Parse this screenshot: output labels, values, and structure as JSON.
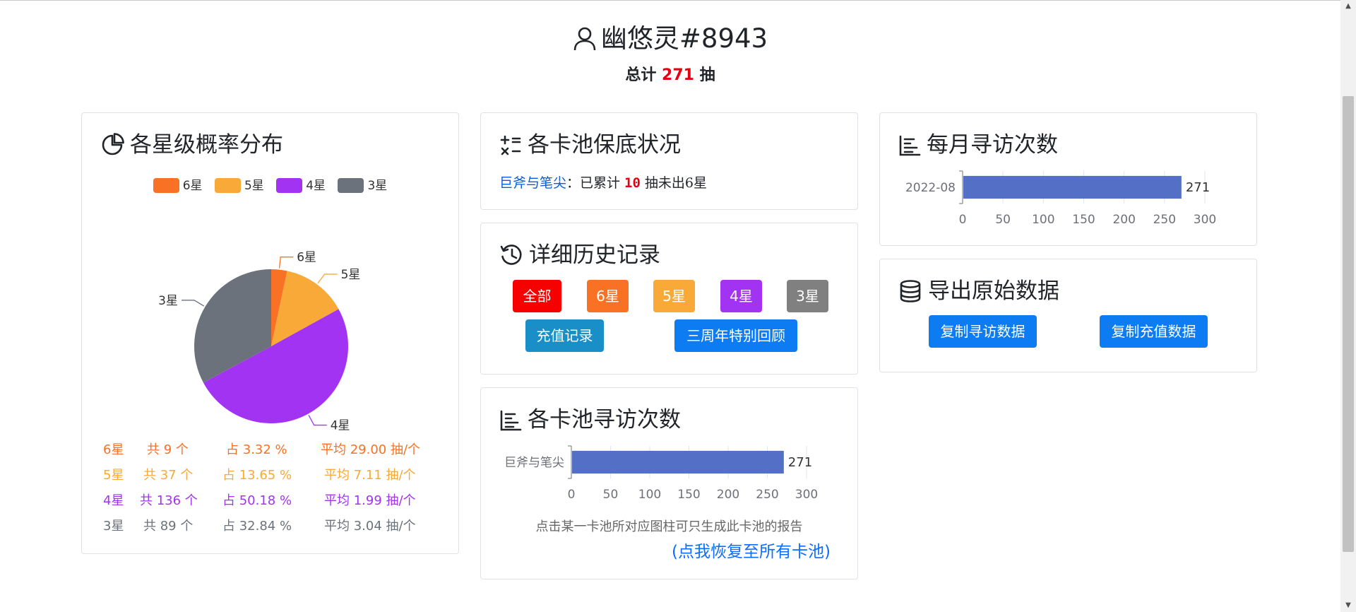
{
  "header": {
    "username": "幽悠灵#8943",
    "total_prefix": "总计",
    "total_count": "271",
    "total_suffix": "抽"
  },
  "distribution": {
    "title": "各星级概率分布",
    "legend": [
      {
        "label": "6星",
        "color": "#f97124"
      },
      {
        "label": "5星",
        "color": "#f8a937"
      },
      {
        "label": "4星",
        "color": "#a233f2"
      },
      {
        "label": "3星",
        "color": "#6c727b"
      }
    ],
    "stats": [
      {
        "star": "6星",
        "count": "共 9 个",
        "percent": "占 3.32 %",
        "avg": "平均 29.00 抽/个",
        "color": "#f97124"
      },
      {
        "star": "5星",
        "count": "共 37 个",
        "percent": "占 13.65 %",
        "avg": "平均 7.11 抽/个",
        "color": "#f8a937"
      },
      {
        "star": "4星",
        "count": "共 136 个",
        "percent": "占 50.18 %",
        "avg": "平均 1.99 抽/个",
        "color": "#a233f2"
      },
      {
        "star": "3星",
        "count": "共 89 个",
        "percent": "占 32.84 %",
        "avg": "平均 3.04 抽/个",
        "color": "#6c727b"
      }
    ]
  },
  "pity": {
    "title": "各卡池保底状况",
    "pool_name": "巨斧与笔尖",
    "text_before": "：已累计",
    "count": "10",
    "text_after": "抽未出6星"
  },
  "history": {
    "title": "详细历史记录",
    "buttons": {
      "all": {
        "label": "全部",
        "color": "#f70000"
      },
      "six": {
        "label": "6星",
        "color": "#f97124"
      },
      "five": {
        "label": "5星",
        "color": "#f8a937"
      },
      "four": {
        "label": "4星",
        "color": "#a233f2"
      },
      "three": {
        "label": "3星",
        "color": "#808080"
      },
      "recharge": {
        "label": "充值记录",
        "color": "#1a8fc7"
      },
      "anniversary": {
        "label": "三周年特别回顾",
        "color": "#0d7cf2"
      }
    }
  },
  "pool_chart": {
    "title": "各卡池寻访次数",
    "hint": "点击某一卡池所对应图柱可只生成此卡池的报告",
    "restore": "(点我恢复至所有卡池)"
  },
  "monthly": {
    "title": "每月寻访次数"
  },
  "export": {
    "title": "导出原始数据",
    "copy_pulls": "复制寻访数据",
    "copy_recharge": "复制充值数据"
  },
  "chart_data": [
    {
      "type": "pie",
      "categories": [
        "6星",
        "5星",
        "4星",
        "3星"
      ],
      "values": [
        9,
        37,
        136,
        89
      ],
      "colors": [
        "#f97124",
        "#f8a937",
        "#a233f2",
        "#6c727b"
      ],
      "legend": "top"
    },
    {
      "type": "bar",
      "orientation": "horizontal",
      "categories": [
        "巨斧与笔尖"
      ],
      "values": [
        271
      ],
      "xlim": [
        0,
        300
      ],
      "ticks": [
        0,
        50,
        100,
        150,
        200,
        250,
        300
      ],
      "color": "#5470c6"
    },
    {
      "type": "bar",
      "orientation": "horizontal",
      "categories": [
        "2022-08"
      ],
      "values": [
        271
      ],
      "xlim": [
        0,
        300
      ],
      "ticks": [
        0,
        50,
        100,
        150,
        200,
        250,
        300
      ],
      "color": "#5470c6"
    }
  ]
}
